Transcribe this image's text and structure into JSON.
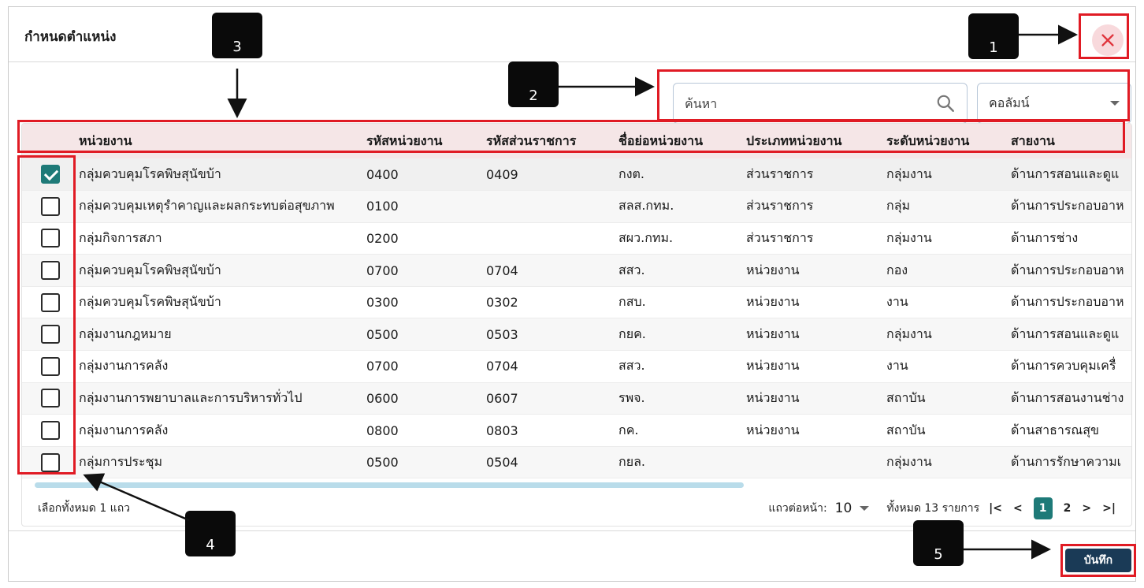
{
  "dialog": {
    "title": "กำหนดตำแหน่ง",
    "close_icon": "close-icon",
    "close_color": "#e0343c"
  },
  "toolbar": {
    "search_placeholder": "ค้นหา",
    "search_icon": "search-icon",
    "column_select_value": "คอลัมน์"
  },
  "table": {
    "columns": [
      "หน่วยงาน",
      "รหัสหน่วยงาน",
      "รหัสส่วนราชการ",
      "ชื่อย่อหน่วยงาน",
      "ประเภทหน่วยงาน",
      "ระดับหน่วยงาน",
      "สายงาน"
    ],
    "rows": [
      {
        "checked": true,
        "unit": "กลุ่มควบคุมโรคพิษสุนัขบ้า",
        "unit_code": "0400",
        "gov_code": "0409",
        "abbr": "กงต.",
        "type": "ส่วนราชการ",
        "level": "กลุ่มงาน",
        "line": "ด้านการสอนและดูแ"
      },
      {
        "checked": false,
        "unit": "กลุ่มควบคุมเหตุรำคาญและผลกระทบต่อสุขภาพ",
        "unit_code": "0100",
        "gov_code": "",
        "abbr": "สลส.กทม.",
        "type": "ส่วนราชการ",
        "level": "กลุ่ม",
        "line": "ด้านการประกอบอาห"
      },
      {
        "checked": false,
        "unit": "กลุ่มกิจการสภา",
        "unit_code": "0200",
        "gov_code": "",
        "abbr": "สผว.กทม.",
        "type": "ส่วนราชการ",
        "level": "กลุ่มงาน",
        "line": "ด้านการช่าง"
      },
      {
        "checked": false,
        "unit": "กลุ่มควบคุมโรคพิษสุนัขบ้า",
        "unit_code": "0700",
        "gov_code": "0704",
        "abbr": "สสว.",
        "type": "หน่วยงาน",
        "level": "กอง",
        "line": "ด้านการประกอบอาห"
      },
      {
        "checked": false,
        "unit": "กลุ่มควบคุมโรคพิษสุนัขบ้า",
        "unit_code": "0300",
        "gov_code": "0302",
        "abbr": "กสบ.",
        "type": "หน่วยงาน",
        "level": "งาน",
        "line": "ด้านการประกอบอาห"
      },
      {
        "checked": false,
        "unit": "กลุ่มงานกฎหมาย",
        "unit_code": "0500",
        "gov_code": "0503",
        "abbr": "กยค.",
        "type": "หน่วยงาน",
        "level": "กลุ่มงาน",
        "line": "ด้านการสอนและดูแ"
      },
      {
        "checked": false,
        "unit": "กลุ่มงานการคลัง",
        "unit_code": "0700",
        "gov_code": "0704",
        "abbr": "สสว.",
        "type": "หน่วยงาน",
        "level": "งาน",
        "line": "ด้านการควบคุมเครื่"
      },
      {
        "checked": false,
        "unit": "กลุ่มงานการพยาบาลและการบริหารทั่วไป",
        "unit_code": "0600",
        "gov_code": "0607",
        "abbr": "รพจ.",
        "type": "หน่วยงาน",
        "level": "สถาบัน",
        "line": "ด้านการสอนงานช่าง"
      },
      {
        "checked": false,
        "unit": "กลุ่มงานการคลัง",
        "unit_code": "0800",
        "gov_code": "0803",
        "abbr": "กค.",
        "type": "หน่วยงาน",
        "level": "สถาบัน",
        "line": "ด้านสาธารณสุข"
      },
      {
        "checked": false,
        "unit": "กลุ่มการประชุม",
        "unit_code": "0500",
        "gov_code": "0504",
        "abbr": "กยล.",
        "type": "",
        "level": "กลุ่มงาน",
        "line": "ด้านการรักษาความเ"
      }
    ]
  },
  "footer": {
    "selected_text": "เลือกทั้งหมด 1 แถว",
    "per_page_label": "แถวต่อหน้า:",
    "per_page_value": "10",
    "total_text": "ทั้งหมด 13 รายการ",
    "first_page": "|<",
    "prev_page": "<",
    "pages": [
      "1",
      "2"
    ],
    "current_page": "1",
    "next_page": ">",
    "last_page": ">|"
  },
  "actions": {
    "save_label": "บันทึก"
  },
  "annotations": {
    "labels": [
      "1",
      "2",
      "3",
      "4",
      "5"
    ],
    "highlight_color": "#e01b24"
  }
}
